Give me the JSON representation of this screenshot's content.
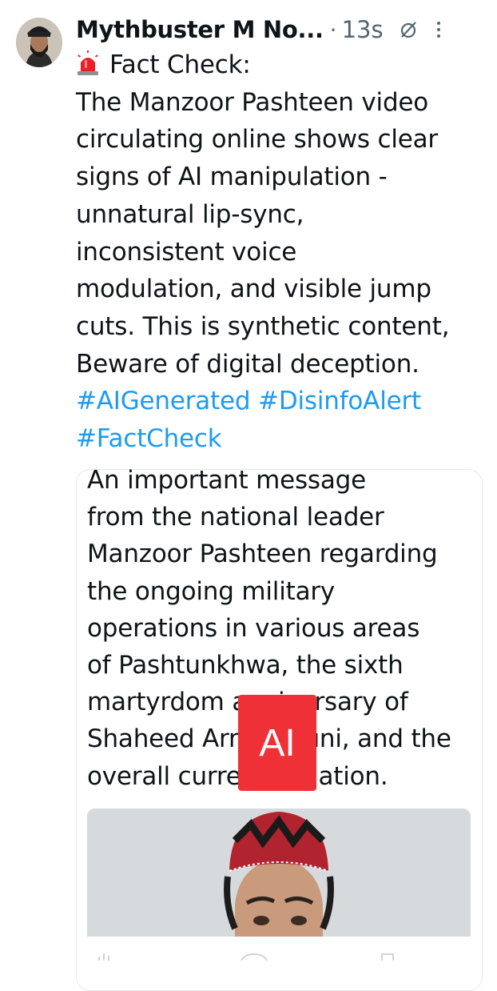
{
  "tweet": {
    "display_name": "Mythbuster M No...",
    "separator": "·",
    "timestamp": "13s",
    "siren_emoji": "siren-icon",
    "text_lines": [
      "Fact Check:",
      "The Manzoor Pashteen video",
      "circulating online shows clear",
      "signs of AI manipulation -",
      "unnatural lip-sync,",
      "inconsistent voice",
      "modulation, and visible jump",
      "cuts. This is synthetic content,",
      "Beware of digital deception."
    ],
    "hashtags_line1": "#AIGenerated #DisinfoAlert",
    "hashtags_line2": "#FactCheck"
  },
  "quoted_post": {
    "text_lines": [
      "An important message",
      "from the national leader",
      "Manzoor Pashteen regarding",
      "the ongoing military",
      "operations in various areas",
      "of Pashtunkhwa, the sixth",
      "martyrdom anniversary of",
      "Shaheed Arman Luni, and the",
      "overall current situation."
    ],
    "overlay_badge": "AI",
    "media": "video-thumbnail"
  },
  "colors": {
    "accent": "#1d9bf0",
    "muted": "#536471",
    "badge": "#f03037"
  }
}
